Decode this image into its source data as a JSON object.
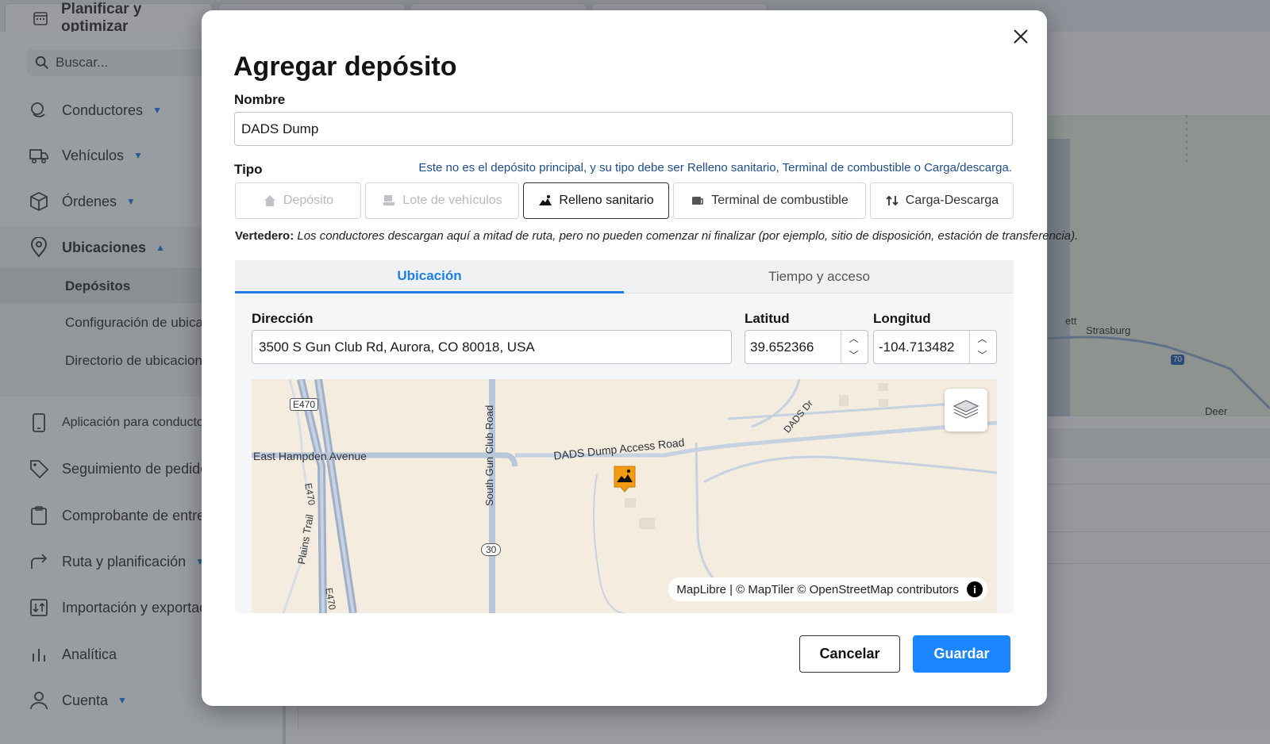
{
  "app": {
    "active_tab": "Planificar y optimizar",
    "search_placeholder": "Buscar...",
    "nav": {
      "drivers": "Conductores",
      "vehicles": "Vehículos",
      "orders": "Órdenes",
      "locations": "Ubicaciones",
      "locations_sub": [
        "Depósitos",
        "Configuración de ubicación",
        "Directorio de ubicaciones"
      ],
      "driver_app": "Aplicación para conductores",
      "order_tracking": "Seguimiento de pedidos",
      "proof_of_delivery": "Comprobante de entrega",
      "route_planning": "Ruta y planificación",
      "import_export": "Importación y exportación",
      "analytics": "Analítica",
      "account": "Cuenta"
    },
    "bg_map_labels": {
      "strasburg": "Strasburg",
      "bennett": "ett",
      "deer": "Deer",
      "interstate": "70"
    }
  },
  "modal": {
    "title": "Agregar depósito",
    "name_label": "Nombre",
    "name_value": "DADS Dump",
    "type_label": "Tipo",
    "type_hint": "Este no es el depósito principal, y su tipo debe ser Relleno sanitario, Terminal de combustible o Carga/descarga.",
    "types": [
      {
        "label": "Depósito",
        "state": "disabled",
        "icon": "home-icon"
      },
      {
        "label": "Lote de vehículos",
        "state": "disabled",
        "icon": "parking-icon"
      },
      {
        "label": "Relleno sanitario",
        "state": "selected",
        "icon": "landfill-icon"
      },
      {
        "label": "Terminal de combustible",
        "state": "normal",
        "icon": "fuel-icon"
      },
      {
        "label": "Carga-Descarga",
        "state": "normal",
        "icon": "up-down-arrows-icon"
      }
    ],
    "type_desc_title": "Vertedero:",
    "type_desc_text": "Los conductores descargan aquí a mitad de ruta, pero no pueden comenzar ni finalizar (por ejemplo, sitio de disposición, estación de transferencia).",
    "tabs": [
      "Ubicación",
      "Tiempo y acceso"
    ],
    "active_tab": "Ubicación",
    "address_label": "Dirección",
    "address_value": "3500 S Gun Club Rd, Aurora, CO 80018, USA",
    "lat_label": "Latitud",
    "lat_value": "39.652366",
    "lng_label": "Longitud",
    "lng_value": "-104.713482",
    "map": {
      "labels": {
        "e470_shield": "E470",
        "east_hampden": "East Hampden Avenue",
        "south_gun_club": "South Gun Club Road",
        "dads_access": "DADS Dump Access Road",
        "dads_dr": "DADS Dr",
        "e470_road": "E470",
        "e470_road2": "E470",
        "route30": "30",
        "plains_trail": "Plains Trail"
      },
      "attribution": "MapLibre | © MapTiler © OpenStreetMap contributors",
      "marker_color": "#f39c12"
    },
    "cancel_label": "Cancelar",
    "save_label": "Guardar",
    "accent": "#1a85ff"
  }
}
